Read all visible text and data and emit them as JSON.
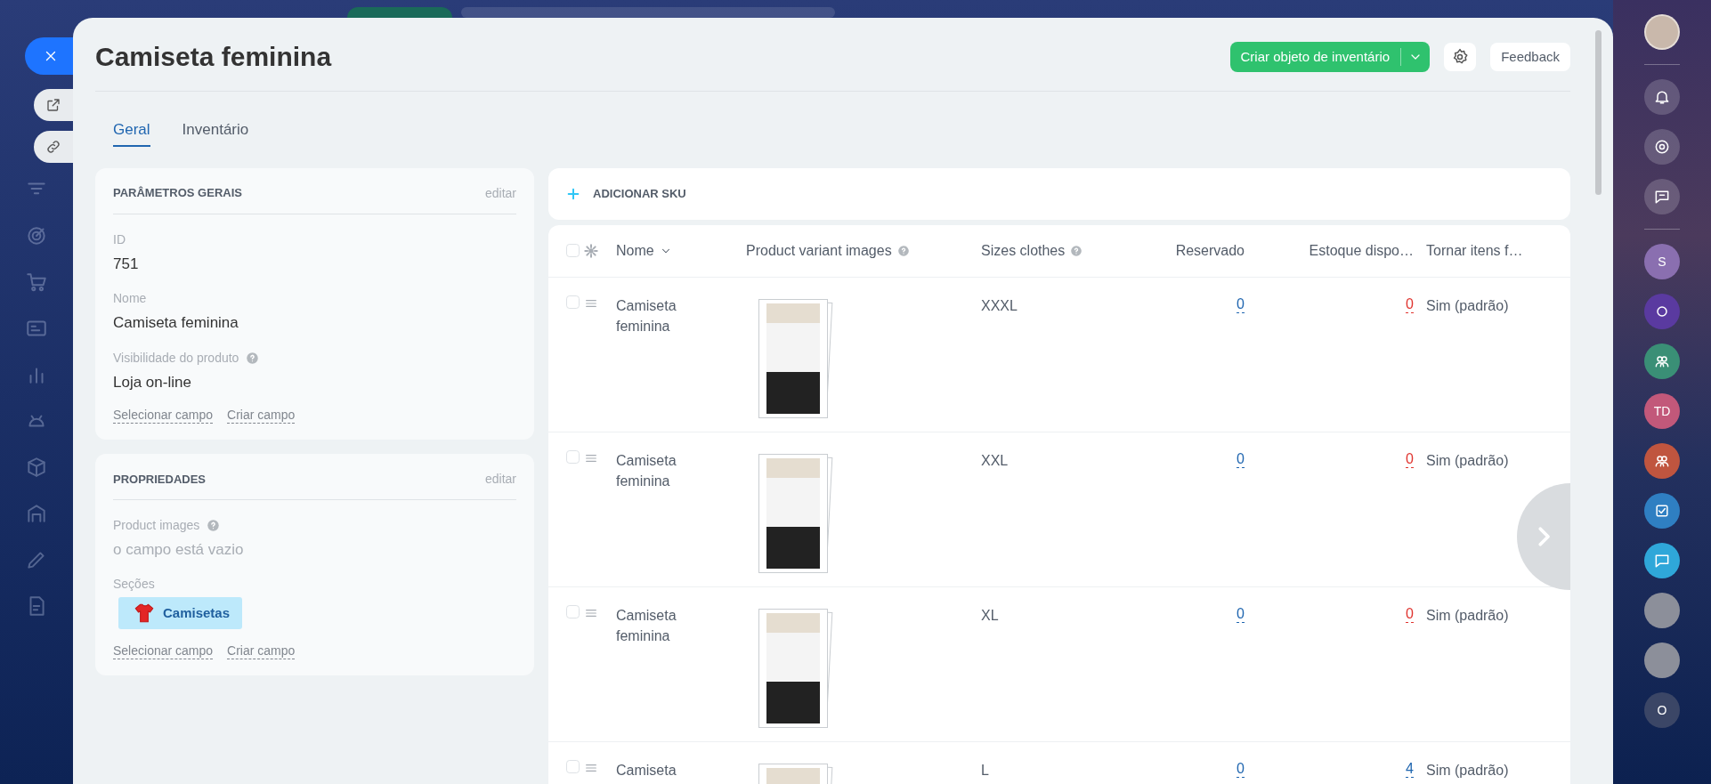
{
  "header": {
    "title": "Camiseta feminina",
    "create_button": "Criar objeto de inventário",
    "feedback_button": "Feedback"
  },
  "tabs": [
    {
      "label": "Geral",
      "selected": true
    },
    {
      "label": "Inventário",
      "selected": false
    }
  ],
  "general_card": {
    "title": "PARÂMETROS GERAIS",
    "edit_link": "editar",
    "fields": [
      {
        "kind": "text",
        "label": "ID",
        "value": "751",
        "help": false
      },
      {
        "kind": "text",
        "label": "Nome",
        "value": "Camiseta feminina",
        "help": false
      },
      {
        "kind": "text",
        "label": "Visibilidade do produto",
        "value": "Loja on-line",
        "help": true
      }
    ],
    "links": [
      "Selecionar campo",
      "Criar campo"
    ]
  },
  "properties_card": {
    "title": "PROPRIEDADES",
    "edit_link": "editar",
    "fields": [
      {
        "kind": "empty",
        "label": "Product images",
        "value": "o campo está vazio",
        "help": true
      },
      {
        "kind": "tag",
        "label": "Seções",
        "value": "Camisetas",
        "help": false
      }
    ],
    "links": [
      "Selecionar campo",
      "Criar campo"
    ]
  },
  "sku_bar": {
    "label": "ADICIONAR SKU"
  },
  "table": {
    "all_checked": false,
    "columns": [
      {
        "label": "Nome",
        "sortable": true,
        "help": false
      },
      {
        "label": "Product variant images",
        "sortable": false,
        "help": true
      },
      {
        "label": "Sizes clothes",
        "sortable": false,
        "help": true
      },
      {
        "label": "Reservado",
        "sortable": false,
        "help": false
      },
      {
        "label": "Estoque dispo…",
        "sortable": false,
        "help": false
      },
      {
        "label": "Tornar itens f…",
        "sortable": false,
        "help": false
      }
    ],
    "rows": [
      {
        "checked": false,
        "name": "Camiseta feminina",
        "size": "XXXL",
        "reserved": "0",
        "stock": "0",
        "stock_alert": true,
        "option": "Sim (padrão)"
      },
      {
        "checked": false,
        "name": "Camiseta feminina",
        "size": "XXL",
        "reserved": "0",
        "stock": "0",
        "stock_alert": true,
        "option": "Sim (padrão)"
      },
      {
        "checked": false,
        "name": "Camiseta feminina",
        "size": "XL",
        "reserved": "0",
        "stock": "0",
        "stock_alert": true,
        "option": "Sim (padrão)"
      },
      {
        "checked": false,
        "name": "Camiseta",
        "size": "L",
        "reserved": "0",
        "stock": "4",
        "stock_alert": false,
        "option": "Sim (padrão)"
      }
    ]
  },
  "right_sidebar": {
    "initials": [
      {
        "text": "S",
        "color": "#8a6fb0"
      },
      {
        "text": "TD",
        "color": "#c2587a"
      },
      {
        "text": "O",
        "color": "#3b4666"
      }
    ]
  }
}
